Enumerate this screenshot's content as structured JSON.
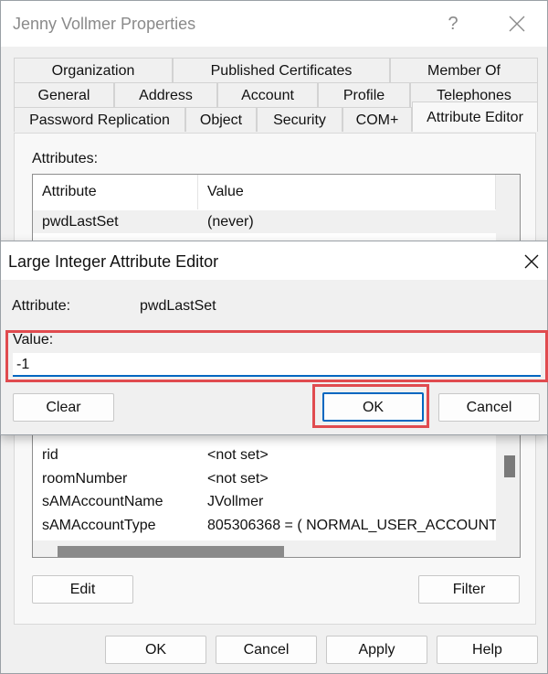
{
  "window": {
    "title": "Jenny Vollmer Properties",
    "help_glyph": "?",
    "tabs_row1": [
      "Organization",
      "Published Certificates",
      "Member Of"
    ],
    "tabs_row2": [
      "General",
      "Address",
      "Account",
      "Profile",
      "Telephones"
    ],
    "tabs_row3": [
      "Password Replication",
      "Object",
      "Security",
      "COM+",
      "Attribute Editor"
    ],
    "active_tab": "Attribute Editor"
  },
  "attribute_editor": {
    "attributes_label": "Attributes:",
    "columns": [
      "Attribute",
      "Value"
    ],
    "top_rows": [
      {
        "attr": "pwdLastSet",
        "value": "(never)",
        "selected": true
      }
    ],
    "bottom_rows": [
      {
        "attr": "rid",
        "value": "<not set>"
      },
      {
        "attr": "roomNumber",
        "value": "<not set>"
      },
      {
        "attr": "sAMAccountName",
        "value": "JVollmer"
      },
      {
        "attr": "sAMAccountType",
        "value": "805306368 = ( NORMAL_USER_ACCOUNT"
      }
    ],
    "edit_label": "Edit",
    "filter_label": "Filter"
  },
  "footer": {
    "ok": "OK",
    "cancel": "Cancel",
    "apply": "Apply",
    "help": "Help"
  },
  "dialog": {
    "title": "Large Integer Attribute Editor",
    "attribute_label": "Attribute:",
    "attribute_value": "pwdLastSet",
    "value_label": "Value:",
    "value_input": "-1",
    "clear_label": "Clear",
    "ok_label": "OK",
    "cancel_label": "Cancel"
  },
  "colors": {
    "highlight": "#e04b4f",
    "accent": "#0067c0"
  }
}
